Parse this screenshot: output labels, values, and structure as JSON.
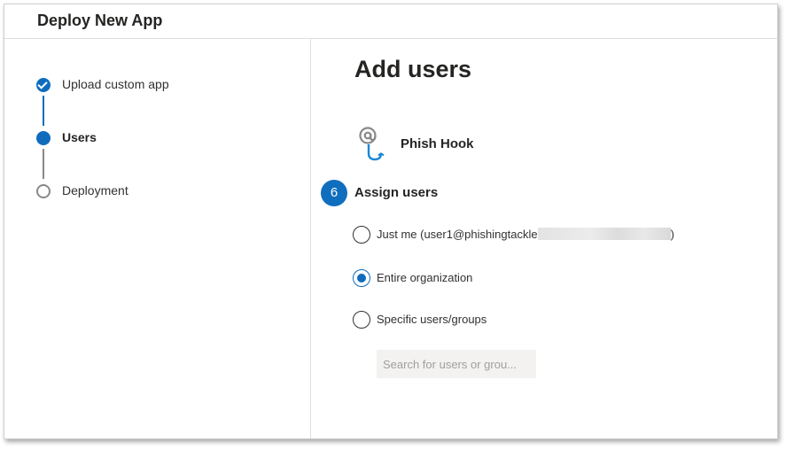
{
  "dialog": {
    "title": "Deploy New App"
  },
  "steps": [
    {
      "label": "Upload custom app",
      "status": "done"
    },
    {
      "label": "Users",
      "status": "current"
    },
    {
      "label": "Deployment",
      "status": "pending"
    }
  ],
  "main": {
    "title": "Add users",
    "app": {
      "name": "Phish Hook",
      "icon": "at-hook-icon"
    },
    "annotation_badge": "6",
    "assign": {
      "title": "Assign users",
      "options": [
        {
          "label": "Just me (user1@phishingtackle",
          "suffix": ")",
          "checked": false
        },
        {
          "label": "Entire organization",
          "checked": true
        },
        {
          "label": "Specific users/groups",
          "checked": false
        }
      ],
      "search_placeholder": "Search for users or grou..."
    }
  },
  "colors": {
    "accent": "#0f6cbd",
    "text": "#323130",
    "border": "#e1dfdd"
  }
}
